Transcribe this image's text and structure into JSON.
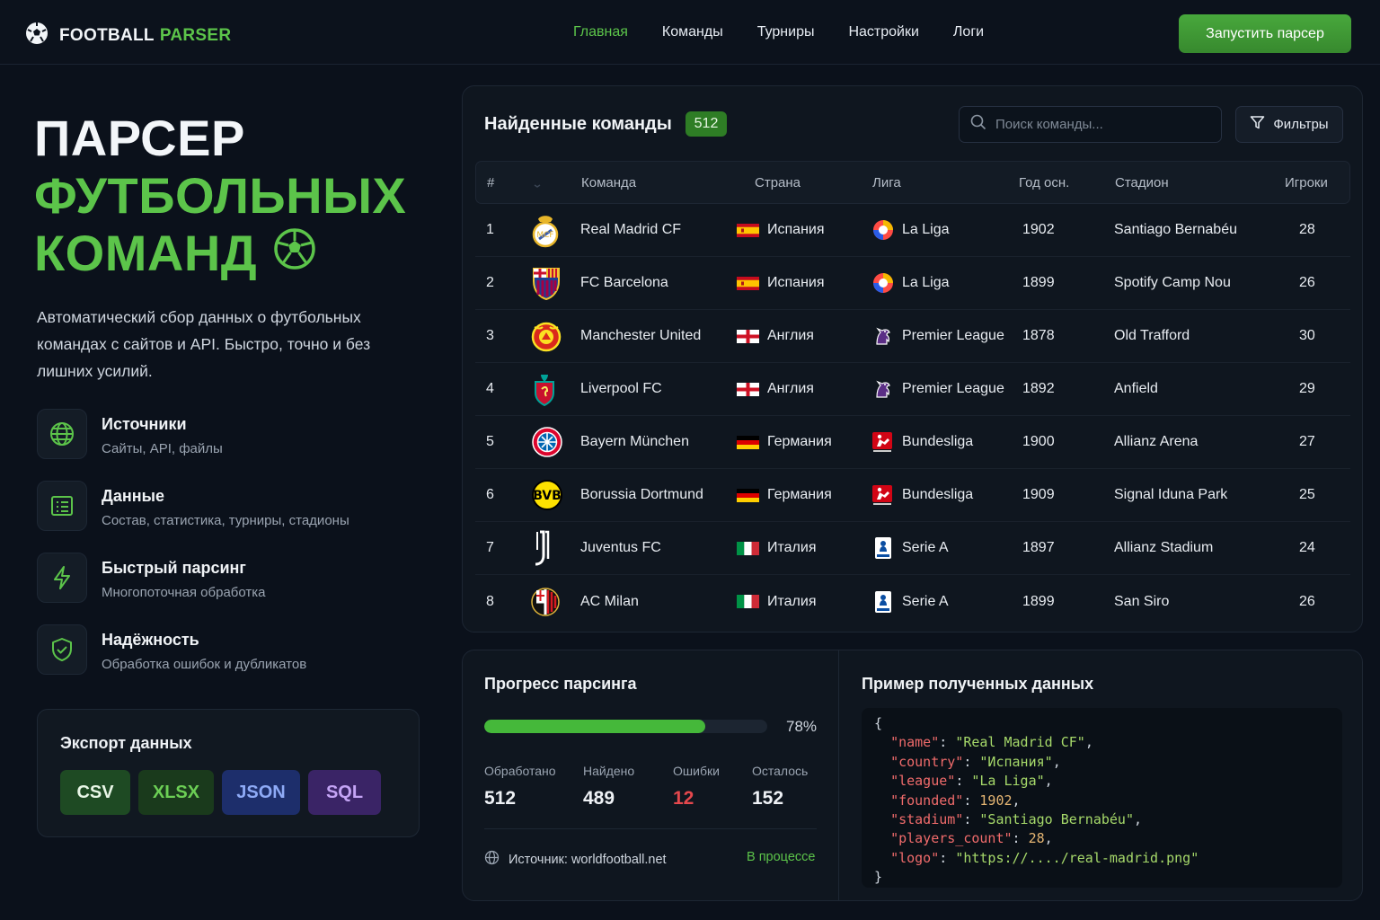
{
  "brand": {
    "part1": "FOOTBALL",
    "part2": "PARSER"
  },
  "nav": [
    {
      "label": "Главная",
      "active": true
    },
    {
      "label": "Команды",
      "active": false
    },
    {
      "label": "Турниры",
      "active": false
    },
    {
      "label": "Настройки",
      "active": false
    },
    {
      "label": "Логи",
      "active": false
    }
  ],
  "run_button": "Запустить парсер",
  "hero": {
    "line1": "ПАРСЕР",
    "line2": "ФУТБОЛЬНЫХ",
    "line3": "КОМАНД"
  },
  "description": "Автоматический сбор данных о футбольных командах с сайтов и API. Быстро, точно и без лишних усилий.",
  "features": [
    {
      "title": "Источники",
      "sub": "Сайты, API, файлы",
      "icon": "globe-icon"
    },
    {
      "title": "Данные",
      "sub": "Состав, статистика, турниры, стадионы",
      "icon": "list-icon"
    },
    {
      "title": "Быстрый парсинг",
      "sub": "Многопоточная обработка",
      "icon": "lightning-icon"
    },
    {
      "title": "Надёжность",
      "sub": "Обработка ошибок и дубликатов",
      "icon": "shield-check-icon"
    }
  ],
  "export": {
    "title": "Экспорт данных",
    "buttons": [
      "CSV",
      "XLSX",
      "JSON",
      "SQL"
    ]
  },
  "teams_panel": {
    "title": "Найденные команды",
    "count": "512",
    "search_placeholder": "Поиск команды...",
    "filter_label": "Фильтры",
    "columns": {
      "num": "#",
      "team": "Команда",
      "country": "Страна",
      "league": "Лига",
      "year": "Год осн.",
      "stadium": "Стадион",
      "players": "Игроки"
    },
    "rows": [
      {
        "num": "1",
        "team": "Real Madrid CF",
        "country": "Испания",
        "flag": "spain",
        "league": "La Liga",
        "league_icon": "laliga",
        "year": "1902",
        "stadium": "Santiago Bernabéu",
        "players": "28",
        "logo": "real-madrid-logo"
      },
      {
        "num": "2",
        "team": "FC Barcelona",
        "country": "Испания",
        "flag": "spain",
        "league": "La Liga",
        "league_icon": "laliga",
        "year": "1899",
        "stadium": "Spotify Camp Nou",
        "players": "26",
        "logo": "barcelona-logo"
      },
      {
        "num": "3",
        "team": "Manchester United",
        "country": "Англия",
        "flag": "england",
        "league": "Premier League",
        "league_icon": "premier",
        "year": "1878",
        "stadium": "Old Trafford",
        "players": "30",
        "logo": "man-united-logo"
      },
      {
        "num": "4",
        "team": "Liverpool FC",
        "country": "Англия",
        "flag": "england",
        "league": "Premier League",
        "league_icon": "premier",
        "year": "1892",
        "stadium": "Anfield",
        "players": "29",
        "logo": "liverpool-logo"
      },
      {
        "num": "5",
        "team": "Bayern München",
        "country": "Германия",
        "flag": "germany",
        "league": "Bundesliga",
        "league_icon": "bundesliga",
        "year": "1900",
        "stadium": "Allianz Arena",
        "players": "27",
        "logo": "bayern-logo"
      },
      {
        "num": "6",
        "team": "Borussia Dortmund",
        "country": "Германия",
        "flag": "germany",
        "league": "Bundesliga",
        "league_icon": "bundesliga",
        "year": "1909",
        "stadium": "Signal Iduna Park",
        "players": "25",
        "logo": "dortmund-logo"
      },
      {
        "num": "7",
        "team": "Juventus FC",
        "country": "Италия",
        "flag": "italy",
        "league": "Serie A",
        "league_icon": "seriea",
        "year": "1897",
        "stadium": "Allianz Stadium",
        "players": "24",
        "logo": "juventus-logo"
      },
      {
        "num": "8",
        "team": "AC Milan",
        "country": "Италия",
        "flag": "italy",
        "league": "Serie A",
        "league_icon": "seriea",
        "year": "1899",
        "stadium": "San Siro",
        "players": "26",
        "logo": "milan-logo"
      }
    ]
  },
  "progress": {
    "title": "Прогресс парсинга",
    "fraction": 0.78,
    "percent_label": "78%",
    "stats": [
      {
        "label": "Обработано",
        "value": "512",
        "error": false
      },
      {
        "label": "Найдено",
        "value": "489",
        "error": false
      },
      {
        "label": "Ошибки",
        "value": "12",
        "error": true
      },
      {
        "label": "Осталось",
        "value": "152",
        "error": false
      }
    ],
    "source": "Источник: worldfootball.net",
    "status": "В процессе"
  },
  "sample": {
    "title": "Пример полученных данных",
    "fields": [
      {
        "key": "\"name\"",
        "value": "\"Real Madrid CF\"",
        "kind": "s"
      },
      {
        "key": "\"country\"",
        "value": "\"Испания\"",
        "kind": "s"
      },
      {
        "key": "\"league\"",
        "value": "\"La Liga\"",
        "kind": "s"
      },
      {
        "key": "\"founded\"",
        "value": "1902",
        "kind": "n"
      },
      {
        "key": "\"stadium\"",
        "value": "\"Santiago Bernabéu\"",
        "kind": "s"
      },
      {
        "key": "\"players_count\"",
        "value": "28",
        "kind": "n"
      },
      {
        "key": "\"logo\"",
        "value": "\"https://..../real-madrid.png\"",
        "kind": "s"
      }
    ]
  },
  "colors": {
    "accent": "#5cc44a",
    "background": "#0b111b",
    "error": "#e5484d"
  }
}
